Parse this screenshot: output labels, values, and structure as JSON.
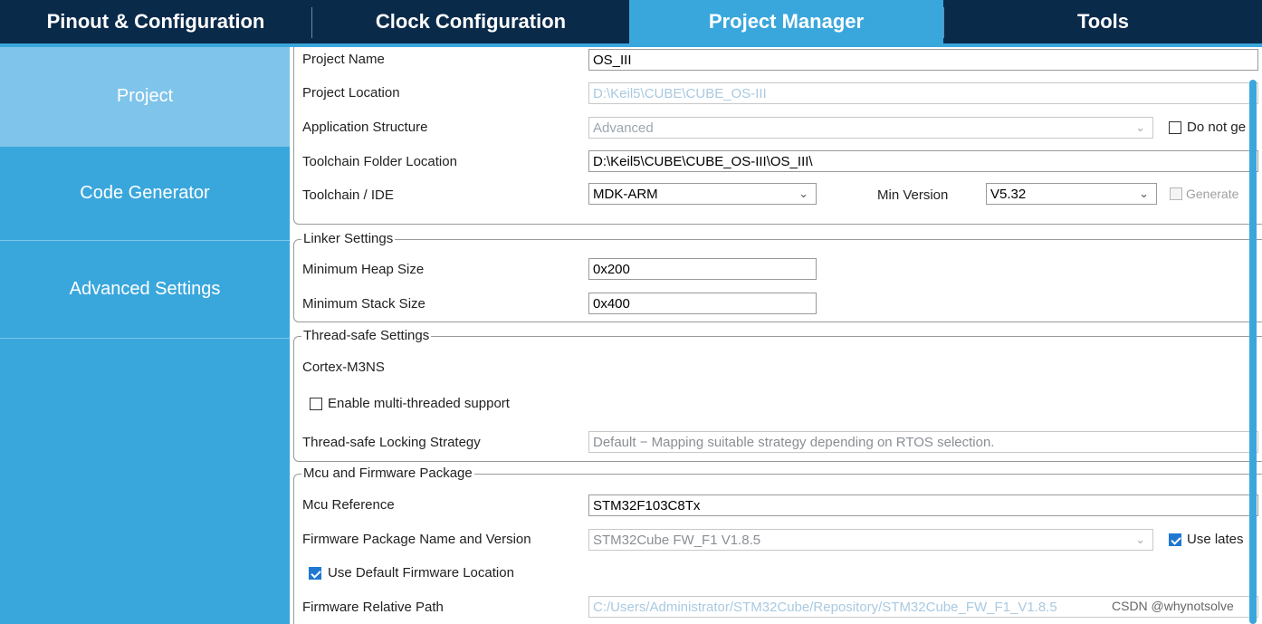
{
  "tabs": {
    "pinout": "Pinout & Configuration",
    "clock": "Clock Configuration",
    "project_manager": "Project Manager",
    "tools": "Tools"
  },
  "sidebar": {
    "items": [
      "Project",
      "Code Generator",
      "Advanced Settings"
    ],
    "active": "Project"
  },
  "project": {
    "name_label": "Project Name",
    "name_value": "OS_III",
    "location_label": "Project Location",
    "location_value": "D:\\Keil5\\CUBE\\CUBE_OS-III",
    "structure_label": "Application Structure",
    "structure_value": "Advanced",
    "do_not_gen_label": "Do not ge",
    "toolchain_folder_label": "Toolchain Folder Location",
    "toolchain_folder_value": "D:\\Keil5\\CUBE\\CUBE_OS-III\\OS_III\\",
    "toolchain_label": "Toolchain / IDE",
    "toolchain_value": "MDK-ARM",
    "min_version_label": "Min Version",
    "min_version_value": "V5.32",
    "generate_label": "Generate"
  },
  "linker": {
    "title": "Linker Settings",
    "heap_label": "Minimum Heap Size",
    "heap_value": "0x200",
    "stack_label": "Minimum Stack Size",
    "stack_value": "0x400"
  },
  "thread_safe": {
    "title": "Thread-safe Settings",
    "core": "Cortex-M3NS",
    "multithread_label": "Enable multi-threaded support",
    "strategy_label": "Thread-safe Locking Strategy",
    "strategy_value": "Default  −  Mapping suitable strategy depending on RTOS selection."
  },
  "mcu": {
    "title": "Mcu and Firmware Package",
    "ref_label": "Mcu Reference",
    "ref_value": "STM32F103C8Tx",
    "fw_label": "Firmware Package Name and Version",
    "fw_value": "STM32Cube FW_F1 V1.8.5",
    "use_latest_label": "Use lates",
    "use_default_label": "Use Default Firmware Location",
    "rel_path_label": "Firmware Relative Path",
    "rel_path_value": "C:/Users/Administrator/STM32Cube/Repository/STM32Cube_FW_F1_V1.8.5"
  },
  "watermark": "CSDN @whynotsolve",
  "icons": {
    "dropdown": "chevron-down-icon",
    "check": "checkmark-icon"
  },
  "colors": {
    "tabbar": "#0a2a4a",
    "accent": "#3aa7dc",
    "active_nav": "#7fc4ea"
  }
}
